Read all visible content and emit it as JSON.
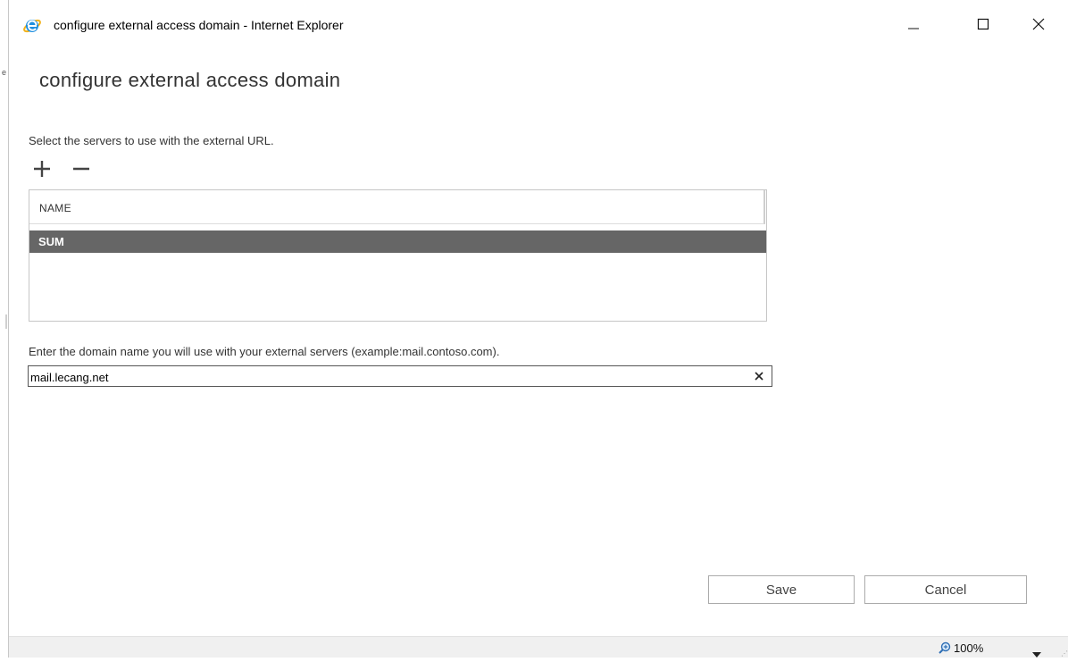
{
  "window": {
    "title": "configure external access domain - Internet Explorer",
    "icon": "ie-icon",
    "controls": {
      "minimize": "minimize-icon",
      "maximize": "maximize-icon",
      "close": "close-icon"
    }
  },
  "left_edge": {
    "mark": "e"
  },
  "dialog": {
    "title": "configure external access domain",
    "instruction": "Select the servers to use with the external URL.",
    "toolbar": {
      "add_icon": "plus-icon",
      "remove_icon": "minus-icon"
    },
    "table": {
      "columns": [
        "NAME"
      ],
      "rows": [
        {
          "name": "SUM",
          "selected": true
        }
      ]
    },
    "domain": {
      "label": "Enter the domain name you will use with your external servers (example:mail.contoso.com).",
      "value": "mail.lecang.net",
      "clear_icon": "clear-x-icon"
    },
    "buttons": {
      "save": "Save",
      "cancel": "Cancel"
    }
  },
  "statusbar": {
    "zoom_icon": "zoom-magnifier-icon",
    "zoom": "100%",
    "dropdown_icon": "chevron-down-icon"
  },
  "colors": {
    "selected_row_bg": "#666666",
    "selected_row_text": "#ffffff",
    "statusbar_bg": "#f0f0f0",
    "ie_blue": "#1e8fe0",
    "ie_gold": "#f2b21b"
  }
}
